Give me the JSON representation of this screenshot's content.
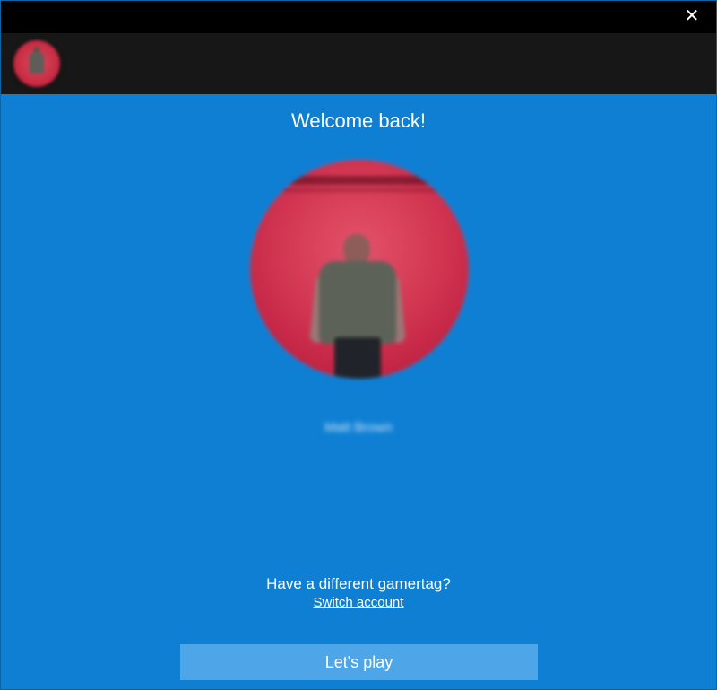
{
  "window": {
    "close_label": "✕"
  },
  "main": {
    "welcome_text": "Welcome back!",
    "username": "Matt Brown",
    "different_gamertag_text": "Have a different gamertag?",
    "switch_account_label": "Switch account",
    "play_button_label": "Let's play"
  },
  "colors": {
    "titlebar": "#000000",
    "header": "#171717",
    "main_background": "#0f7fd3",
    "play_button": "#4ea5e8",
    "avatar_red": "#d43954",
    "text": "#ffffff"
  },
  "icons": {
    "close": "close-icon"
  }
}
